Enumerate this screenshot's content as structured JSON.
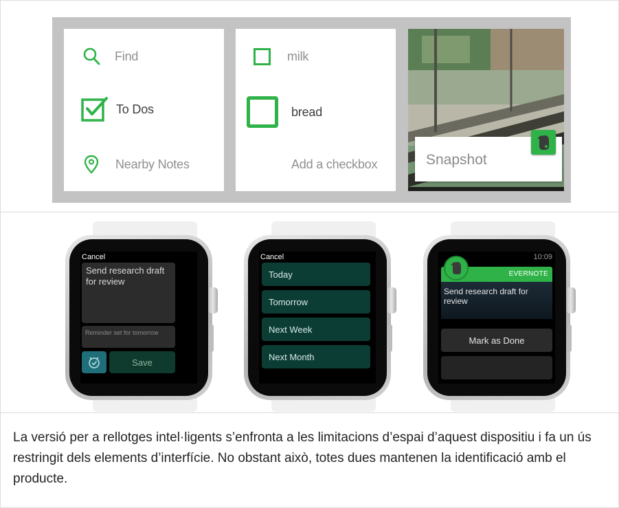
{
  "wear": {
    "nav": [
      {
        "label": "Find",
        "icon": "search-icon"
      },
      {
        "label": "To Dos",
        "icon": "checkbox-checked-icon"
      },
      {
        "label": "Nearby Notes",
        "icon": "location-pin-icon"
      }
    ],
    "checklist": {
      "items": [
        "milk",
        "bread"
      ],
      "add_label": "Add a checkbox"
    },
    "snapshot_label": "Snapshot",
    "accent_color": "#2fb348"
  },
  "watches": {
    "reminder": {
      "cancel": "Cancel",
      "note": "Send research draft for review",
      "status": "Reminder set for tomorrow",
      "save_label": "Save"
    },
    "schedule": {
      "cancel": "Cancel",
      "options": [
        "Today",
        "Tomorrow",
        "Next Week",
        "Next Month"
      ]
    },
    "notification": {
      "time": "10:09",
      "app_name": "EVERNOTE",
      "note": "Send research draft for review",
      "action_label": "Mark as Done"
    }
  },
  "caption": "La versió per a rellotges intel·ligents s’enfronta a les limitacions d’espai d’aquest dispositiu i fa un ús restringit dels elements d’interfície. No obstant això, totes dues mantenen la identificació amb el producte."
}
